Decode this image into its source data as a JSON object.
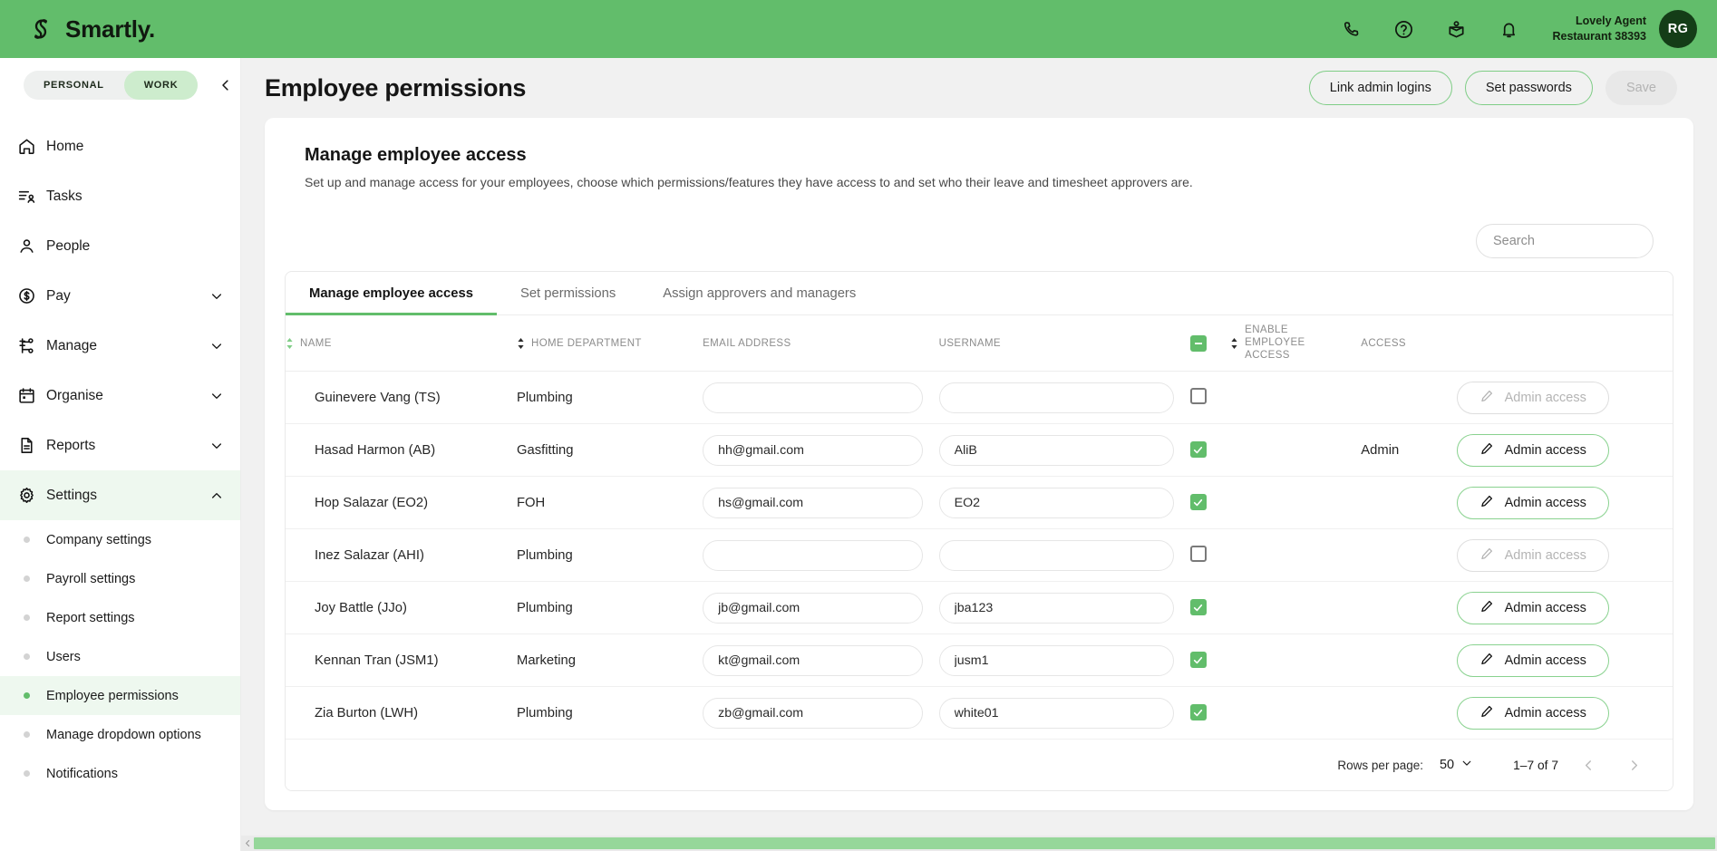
{
  "topbar": {
    "brand": "Smartly.",
    "brand_icon": "spiral-logo-icon",
    "icons": [
      {
        "name": "phone-icon",
        "label": "Phone"
      },
      {
        "name": "help-circle-icon",
        "label": "Help"
      },
      {
        "name": "learning-icon",
        "label": "Learning"
      },
      {
        "name": "bell-icon",
        "label": "Notifications"
      }
    ],
    "user_name": "Lovely Agent",
    "user_org": "Restaurant 38393",
    "avatar_initials": "RG",
    "bg_color": "#62bd6b",
    "avatar_color": "#143d17"
  },
  "sidebar": {
    "segmented": [
      {
        "label": "PERSONAL",
        "active": false
      },
      {
        "label": "WORK",
        "active": true
      }
    ],
    "collapse_icon": "chevron-left-icon",
    "items": [
      {
        "label": "Home",
        "icon": "home-icon",
        "expandable": false,
        "active": false
      },
      {
        "label": "Tasks",
        "icon": "tasks-icon",
        "expandable": false,
        "active": false
      },
      {
        "label": "People",
        "icon": "person-icon",
        "expandable": false,
        "active": false
      },
      {
        "label": "Pay",
        "icon": "dollar-circle-icon",
        "expandable": true,
        "expanded": false,
        "active": false
      },
      {
        "label": "Manage",
        "icon": "org-tree-icon",
        "expandable": true,
        "expanded": false,
        "active": false
      },
      {
        "label": "Organise",
        "icon": "calendar-icon",
        "expandable": true,
        "expanded": false,
        "active": false
      },
      {
        "label": "Reports",
        "icon": "document-icon",
        "expandable": true,
        "expanded": false,
        "active": false
      },
      {
        "label": "Settings",
        "icon": "gear-icon",
        "expandable": true,
        "expanded": true,
        "active": true
      }
    ],
    "sub_items": [
      {
        "label": "Company settings",
        "active": false
      },
      {
        "label": "Payroll settings",
        "active": false
      },
      {
        "label": "Report settings",
        "active": false
      },
      {
        "label": "Users",
        "active": false
      },
      {
        "label": "Employee permissions",
        "active": true
      },
      {
        "label": "Manage dropdown options",
        "active": false
      },
      {
        "label": "Notifications",
        "active": false
      }
    ]
  },
  "page": {
    "title": "Employee permissions",
    "actions": {
      "link_admin_logins": "Link admin logins",
      "set_passwords": "Set passwords",
      "save": "Save"
    },
    "card_title": "Manage employee access",
    "card_subtitle": "Set up and manage access for your employees, choose which permissions/features they have access to and set who their leave and timesheet approvers are."
  },
  "search": {
    "value": "",
    "placeholder": "Search"
  },
  "tabs": [
    {
      "label": "Manage employee access",
      "active": true
    },
    {
      "label": "Set permissions",
      "active": false
    },
    {
      "label": "Assign approvers and managers",
      "active": false
    }
  ],
  "table": {
    "select_all_state": "indeterminate",
    "columns": [
      {
        "label": "NAME",
        "sortable": true
      },
      {
        "label": "HOME DEPARTMENT",
        "sortable": true
      },
      {
        "label": "EMAIL ADDRESS",
        "sortable": false
      },
      {
        "label": "USERNAME",
        "sortable": false
      },
      {
        "label": "ENABLE EMPLOYEE ACCESS",
        "sortable": true
      },
      {
        "label": "ACCESS",
        "sortable": false
      }
    ],
    "admin_access_label": "Admin access",
    "rows": [
      {
        "name": "Guinevere Vang (TS)",
        "department": "Plumbing",
        "email": "",
        "username": "",
        "enabled": false,
        "access": "",
        "admin_button_enabled": false
      },
      {
        "name": "Hasad Harmon (AB)",
        "department": "Gasfitting",
        "email": "hh@gmail.com",
        "username": "AliB",
        "enabled": true,
        "access": "Admin",
        "admin_button_enabled": true
      },
      {
        "name": "Hop Salazar (EO2)",
        "department": "FOH",
        "email": "hs@gmail.com",
        "username": "EO2",
        "enabled": true,
        "access": "",
        "admin_button_enabled": true
      },
      {
        "name": "Inez Salazar (AHI)",
        "department": "Plumbing",
        "email": "",
        "username": "",
        "enabled": false,
        "access": "",
        "admin_button_enabled": false
      },
      {
        "name": "Joy Battle (JJo)",
        "department": "Plumbing",
        "email": "jb@gmail.com",
        "username": "jba123",
        "enabled": true,
        "access": "",
        "admin_button_enabled": true
      },
      {
        "name": "Kennan Tran (JSM1)",
        "department": "Marketing",
        "email": "kt@gmail.com",
        "username": "jusm1",
        "enabled": true,
        "access": "",
        "admin_button_enabled": true
      },
      {
        "name": "Zia Burton (LWH)",
        "department": "Plumbing",
        "email": "zb@gmail.com",
        "username": "white01",
        "enabled": true,
        "access": "",
        "admin_button_enabled": true
      }
    ]
  },
  "pagination": {
    "rows_per_page_label": "Rows per page:",
    "rows_per_page_value": "50",
    "range": "1–7 of 7",
    "prev_icon": "chevron-left-icon",
    "next_icon": "chevron-right-icon"
  },
  "colors": {
    "brand_green": "#62bd6b",
    "accent_border": "#7fcd86",
    "scrollbar_thumb": "#96d79a"
  }
}
